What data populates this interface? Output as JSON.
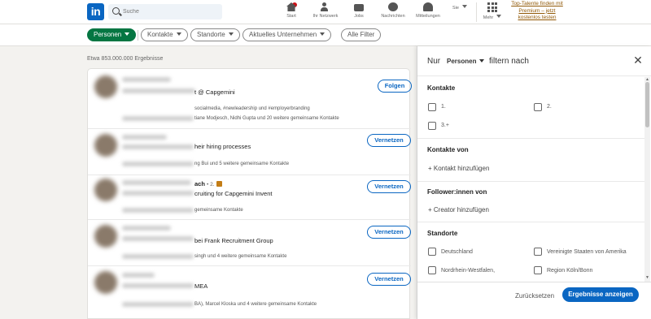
{
  "nav": {
    "logo": "in",
    "search_placeholder": "Suche",
    "items": [
      "Start",
      "Ihr Netzwerk",
      "Jobs",
      "Nachrichten",
      "Mitteilungen",
      "Sie",
      "Mehr"
    ],
    "premium": "Top-Talente finden mit Premium – jetzt kostenlos testen"
  },
  "filters": {
    "personen": "Personen",
    "kontakte": "Kontakte",
    "standorte": "Standorte",
    "unternehmen": "Aktuelles Unternehmen",
    "alle": "Alle Filter"
  },
  "results": {
    "count": "Etwa 853.000.000 Ergebnisse",
    "rows": [
      {
        "line1": "t @ Capgemini",
        "line2": "socialmedia, #newleadership und #employerbranding",
        "line3": "tiane Modjesch, Nidhi Gupta und 20 weitere gemeinsame Kontakte",
        "button": "Folgen"
      },
      {
        "line1": "heir hiring processes",
        "line2": "",
        "line3": "ng Bui und 5 weitere gemeinsame Kontakte",
        "button": "Vernetzen"
      },
      {
        "name": "ach",
        "degree": "• 2.",
        "line1": "cruiting for Capgemini Invent",
        "line3": "gemeinsame Kontakte",
        "button": "Vernetzen"
      },
      {
        "line1": "bei Frank Recruitment Group",
        "line3": "singh und 4 weitere gemeinsame Kontakte",
        "button": "Vernetzen"
      },
      {
        "line1": "MEA",
        "line3": "BA), Marcel Kloska und 4 weitere gemeinsame Kontakte",
        "button": "Vernetzen"
      }
    ]
  },
  "panel": {
    "nur": "Nur",
    "select": "Personen",
    "filtern": "filtern nach",
    "kontakte_title": "Kontakte",
    "kontakte_options": [
      "1.",
      "2.",
      "3.+"
    ],
    "kontakte_von_title": "Kontakte von",
    "kontakte_von_add": "+ Kontakt hinzufügen",
    "follower_title": "Follower:innen von",
    "follower_add": "+ Creator hinzufügen",
    "standorte_title": "Standorte",
    "standorte_options": [
      "Deutschland",
      "Vereinigte Staaten von Amerika",
      "Nordrhein-Westfalen,",
      "Region Köln/Bonn"
    ],
    "reset": "Zurücksetzen",
    "show": "Ergebnisse anzeigen"
  }
}
